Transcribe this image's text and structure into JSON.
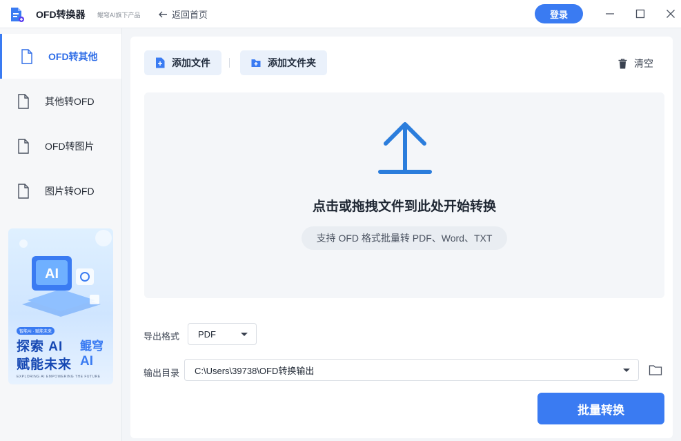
{
  "titlebar": {
    "app_title": "OFD转换器",
    "app_subtitle": "鲲穹AI旗下产品",
    "back_label": "返回首页",
    "login_label": "登录"
  },
  "sidebar": {
    "items": [
      {
        "label": "OFD转其他",
        "active": true
      },
      {
        "label": "其他转OFD",
        "active": false
      },
      {
        "label": "OFD转图片",
        "active": false
      },
      {
        "label": "图片转OFD",
        "active": false
      }
    ],
    "banner": {
      "pill": "智能AI · 赋能未来",
      "slogan_line1": "探索 AI",
      "slogan_line2": "赋能未来",
      "brand_line1": "鲲穹",
      "brand_line2": "AI",
      "tagline": "EXPLORING AI EMPOWERING THE FUTURE"
    }
  },
  "toolbar": {
    "add_file": "添加文件",
    "add_folder": "添加文件夹",
    "clear": "清空"
  },
  "dropzone": {
    "title": "点击或拖拽文件到此处开始转换",
    "hint": "支持 OFD 格式批量转 PDF、Word、TXT"
  },
  "export": {
    "format_label": "导出格式",
    "format_value": "PDF",
    "dir_label": "输出目录",
    "dir_value": "C:\\Users\\39738\\OFD转换输出"
  },
  "actions": {
    "convert": "批量转换"
  },
  "colors": {
    "accent": "#3a7bf2",
    "active_text": "#2f6de7"
  },
  "icons": {
    "logo": "app-logo-icon",
    "back": "arrow-left-icon",
    "minimize": "minimize-icon",
    "maximize": "maximize-icon",
    "close": "close-icon",
    "nav": "document-icon",
    "add_file": "file-plus-icon",
    "add_folder": "folder-plus-icon",
    "clear": "trash-icon",
    "upload": "upload-arrow-icon",
    "folder": "folder-icon",
    "dropdown": "caret-down-icon"
  }
}
